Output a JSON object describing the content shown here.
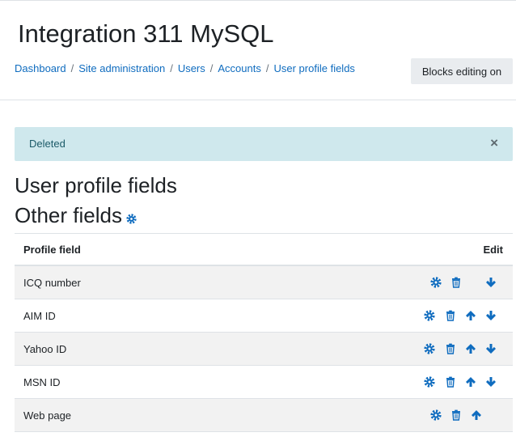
{
  "page": {
    "title": "Integration 311 MySQL",
    "blocks_button": "Blocks editing on"
  },
  "breadcrumb": [
    "Dashboard",
    "Site administration",
    "Users",
    "Accounts",
    "User profile fields"
  ],
  "breadcrumb_separator": "/",
  "alert": {
    "text": "Deleted",
    "close": "×"
  },
  "headings": {
    "section": "User profile fields",
    "category": "Other fields",
    "category_icon": "gear-icon"
  },
  "table": {
    "col_field": "Profile field",
    "col_edit": "Edit",
    "rows": [
      {
        "name": "ICQ number",
        "actions": [
          "edit",
          "delete",
          "down"
        ]
      },
      {
        "name": "AIM ID",
        "actions": [
          "edit",
          "delete",
          "up",
          "down"
        ]
      },
      {
        "name": "Yahoo ID",
        "actions": [
          "edit",
          "delete",
          "up",
          "down"
        ]
      },
      {
        "name": "MSN ID",
        "actions": [
          "edit",
          "delete",
          "up",
          "down"
        ]
      },
      {
        "name": "Web page",
        "actions": [
          "edit",
          "delete",
          "up"
        ]
      }
    ]
  },
  "colors": {
    "link": "#0f6cbf",
    "icon": "#0f6cbf",
    "alert_bg": "#cfe8ed",
    "alert_text": "#1b5a68",
    "stripe": "#f2f2f2"
  }
}
